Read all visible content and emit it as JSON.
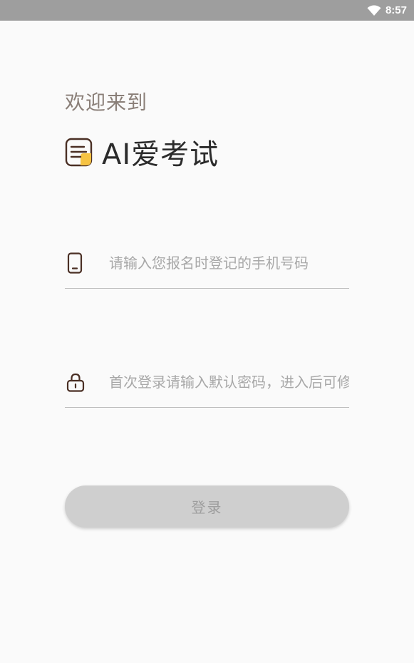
{
  "status_bar": {
    "time": "8:57",
    "wifi_icon": "wifi-icon"
  },
  "header": {
    "welcome": "欢迎来到",
    "app_title": "AI爱考试",
    "logo_icon": "notes-icon",
    "accent_color": "#f6c343"
  },
  "form": {
    "phone": {
      "icon": "phone-icon",
      "placeholder": "请输入您报名时登记的手机号码",
      "value": ""
    },
    "password": {
      "icon": "lock-icon",
      "placeholder": "首次登录请输入默认密码，进入后可修改",
      "value": ""
    },
    "login_label": "登录"
  }
}
